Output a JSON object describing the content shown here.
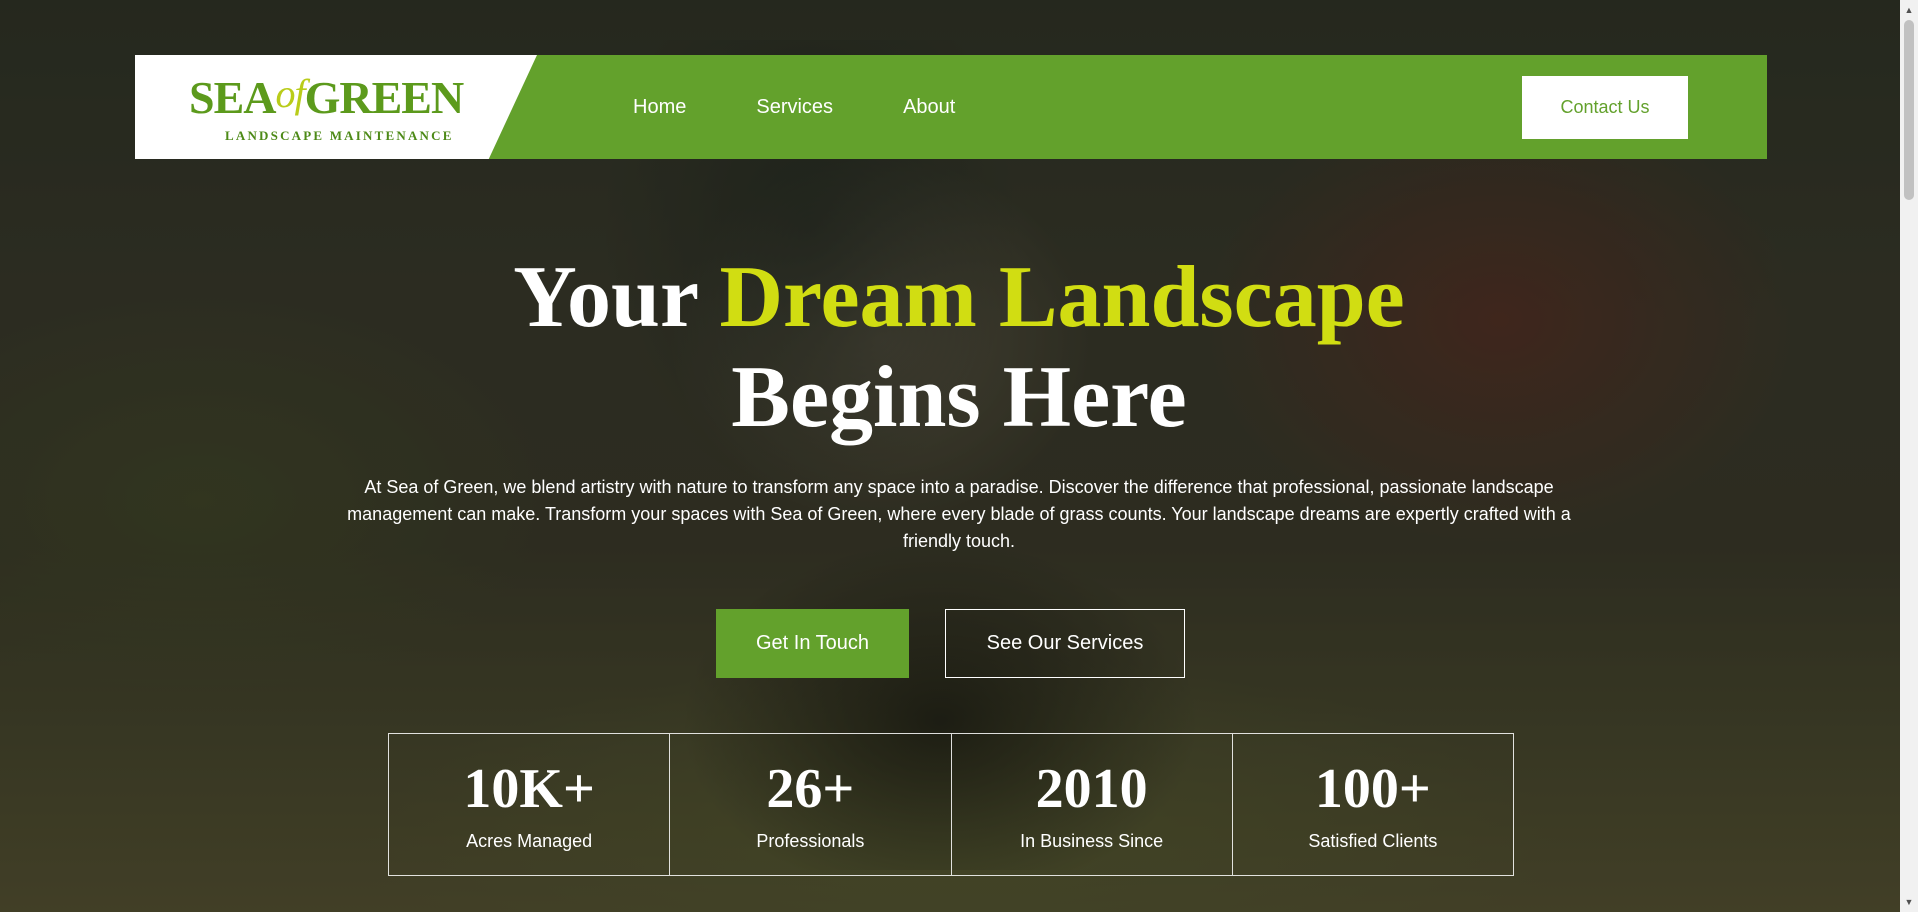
{
  "logo": {
    "sea": "SEA",
    "of": "of",
    "green": "GREEN",
    "tagline": "LANDSCAPE MAINTENANCE"
  },
  "nav": {
    "items": [
      "Home",
      "Services",
      "About"
    ],
    "contact_label": "Contact Us"
  },
  "hero": {
    "title_part1": "Your ",
    "title_accent": "Dream Landscape",
    "title_line2": "Begins Here",
    "description": "At Sea of Green, we blend artistry with nature to transform any space into a paradise. Discover the difference that professional, passionate landscape management can make. Transform your spaces with Sea of Green, where every blade of grass counts. Your landscape dreams are expertly crafted with a friendly touch.",
    "primary_button": "Get In Touch",
    "secondary_button": "See Our Services"
  },
  "stats": [
    {
      "value": "10K+",
      "label": "Acres Managed"
    },
    {
      "value": "26+",
      "label": "Professionals"
    },
    {
      "value": "2010",
      "label": "In Business Since"
    },
    {
      "value": "100+",
      "label": "Satisfied Clients"
    }
  ],
  "colors": {
    "brand_green": "#63a12c",
    "accent_yellow": "#d1dd12"
  }
}
